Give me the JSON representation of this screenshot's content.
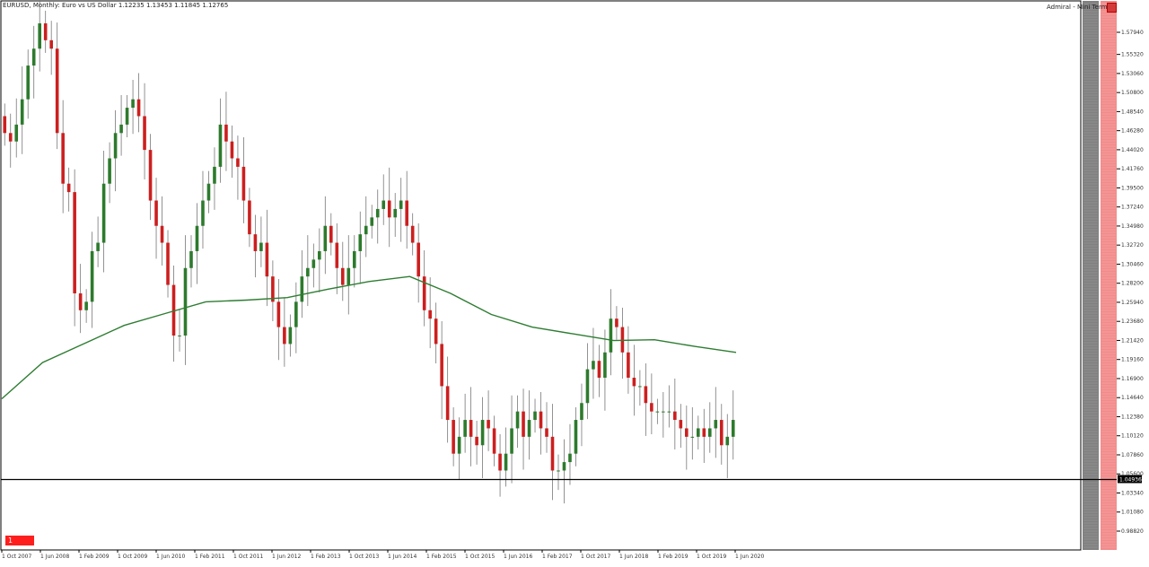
{
  "header": {
    "symbol": "EURUSD, Monthly:",
    "description": "Euro vs US Dollar",
    "ohlc": "1.12235 1.13453 1.11845 1.12765"
  },
  "broker_label": "Admiral - Mini Termin",
  "alert_badge": "1",
  "current_price_label": "1.04936",
  "colors": {
    "bull": "#2d7a2d",
    "bear": "#cc1f1f",
    "ma": "#2e7d32",
    "level_line": "#000000",
    "panel_dark": "#808080",
    "panel_red": "#f28b8b"
  },
  "chart_data": {
    "type": "candlestick",
    "title": "EURUSD, Monthly: Euro vs US Dollar",
    "y_range": [
      0.982,
      1.604
    ],
    "y_ticks": [
      "1.57940",
      "1.55320",
      "1.53060",
      "1.50800",
      "1.48540",
      "1.46280",
      "1.44020",
      "1.41760",
      "1.39500",
      "1.37240",
      "1.34980",
      "1.32720",
      "1.30460",
      "1.28200",
      "1.25940",
      "1.23680",
      "1.21420",
      "1.19160",
      "1.16900",
      "1.14640",
      "1.12380",
      "1.10120",
      "1.07860",
      "1.05600",
      "1.03340",
      "1.01080",
      "0.98820"
    ],
    "x_labels": [
      "1 Oct 2007",
      "1 Jun 2008",
      "1 Feb 2009",
      "1 Oct 2009",
      "1 Jun 2010",
      "1 Feb 2011",
      "1 Oct 2011",
      "1 Jun 2012",
      "1 Feb 2013",
      "1 Oct 2013",
      "1 Jun 2014",
      "1 Feb 2015",
      "1 Oct 2015",
      "1 Jun 2016",
      "1 Feb 2017",
      "1 Oct 2017",
      "1 Jun 2018",
      "1 Feb 2019",
      "1 Oct 2019",
      "1 Jun 2020"
    ],
    "horizontal_level": 1.04936,
    "moving_average": [
      1.145,
      1.188,
      1.21,
      1.232,
      1.246,
      1.26,
      1.262,
      1.265,
      1.275,
      1.284,
      1.29,
      1.27,
      1.245,
      1.23,
      1.222,
      1.214,
      1.215,
      1.207,
      1.2
    ],
    "candles_close_path": [
      1.46,
      1.45,
      1.47,
      1.5,
      1.54,
      1.56,
      1.59,
      1.57,
      1.56,
      1.46,
      1.4,
      1.39,
      1.27,
      1.25,
      1.26,
      1.32,
      1.33,
      1.4,
      1.43,
      1.46,
      1.47,
      1.49,
      1.5,
      1.48,
      1.44,
      1.38,
      1.35,
      1.33,
      1.28,
      1.22,
      1.22,
      1.3,
      1.32,
      1.35,
      1.38,
      1.4,
      1.42,
      1.47,
      1.45,
      1.43,
      1.42,
      1.38,
      1.34,
      1.32,
      1.33,
      1.29,
      1.26,
      1.23,
      1.21,
      1.23,
      1.26,
      1.29,
      1.3,
      1.31,
      1.32,
      1.35,
      1.33,
      1.3,
      1.28,
      1.3,
      1.32,
      1.34,
      1.35,
      1.36,
      1.37,
      1.38,
      1.36,
      1.37,
      1.38,
      1.35,
      1.33,
      1.29,
      1.25,
      1.24,
      1.21,
      1.16,
      1.12,
      1.08,
      1.1,
      1.12,
      1.1,
      1.09,
      1.12,
      1.11,
      1.08,
      1.06,
      1.08,
      1.11,
      1.13,
      1.1,
      1.12,
      1.13,
      1.11,
      1.1,
      1.06,
      1.06,
      1.07,
      1.08,
      1.12,
      1.14,
      1.18,
      1.19,
      1.17,
      1.2,
      1.24,
      1.23,
      1.2,
      1.17,
      1.16,
      1.16,
      1.14,
      1.13,
      1.13,
      1.13,
      1.13,
      1.12,
      1.11,
      1.1,
      1.1,
      1.11,
      1.1,
      1.11,
      1.12,
      1.09,
      1.1,
      1.12
    ]
  }
}
